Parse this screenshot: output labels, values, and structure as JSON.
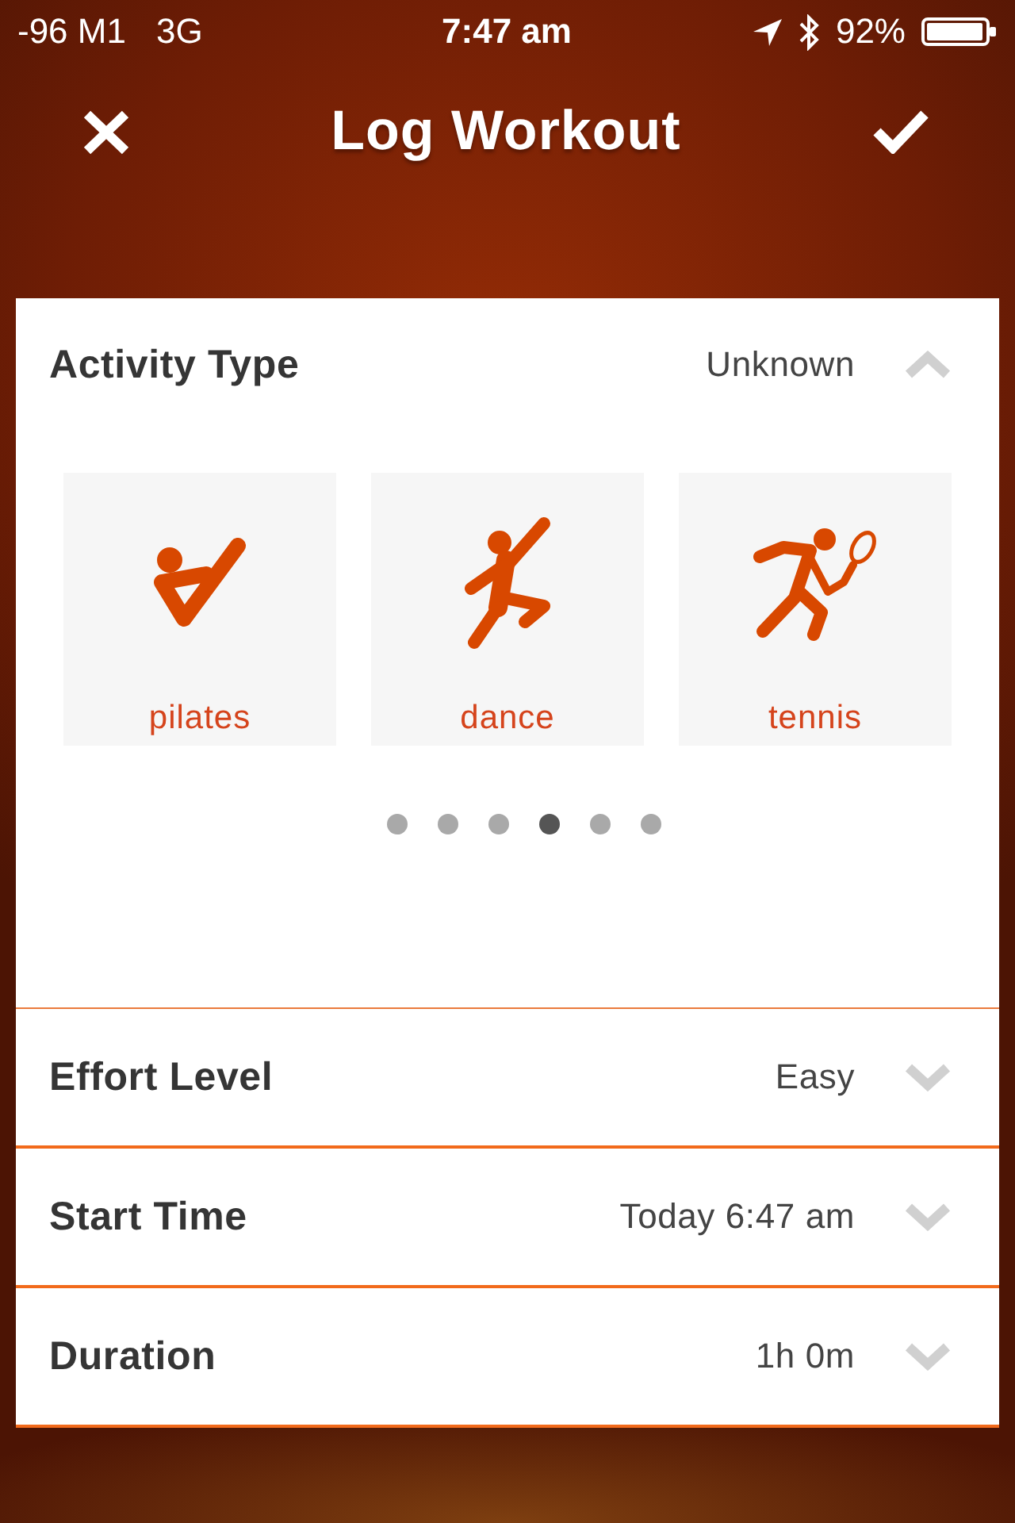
{
  "status_bar": {
    "carrier": "-96 M1",
    "network": "3G",
    "time": "7:47 am",
    "battery": "92%"
  },
  "nav": {
    "title": "Log Workout"
  },
  "activity": {
    "label": "Activity Type",
    "value": "Unknown",
    "expanded": true,
    "tiles": [
      {
        "kind": "pilates",
        "label": "pilates",
        "selected": false
      },
      {
        "kind": "dance",
        "label": "dance",
        "selected": false
      },
      {
        "kind": "tennis",
        "label": "tennis",
        "selected": false
      }
    ],
    "pages": [
      {
        "selected": false
      },
      {
        "selected": false
      },
      {
        "selected": false
      },
      {
        "selected": true
      },
      {
        "selected": false
      },
      {
        "selected": false
      }
    ]
  },
  "fields": [
    {
      "label": "Effort Level",
      "value": "Easy",
      "expanded": false
    },
    {
      "label": "Start Time",
      "value": "Today 6:47 am",
      "expanded": false
    },
    {
      "label": "Duration",
      "value": "1h 0m",
      "expanded": false
    }
  ]
}
